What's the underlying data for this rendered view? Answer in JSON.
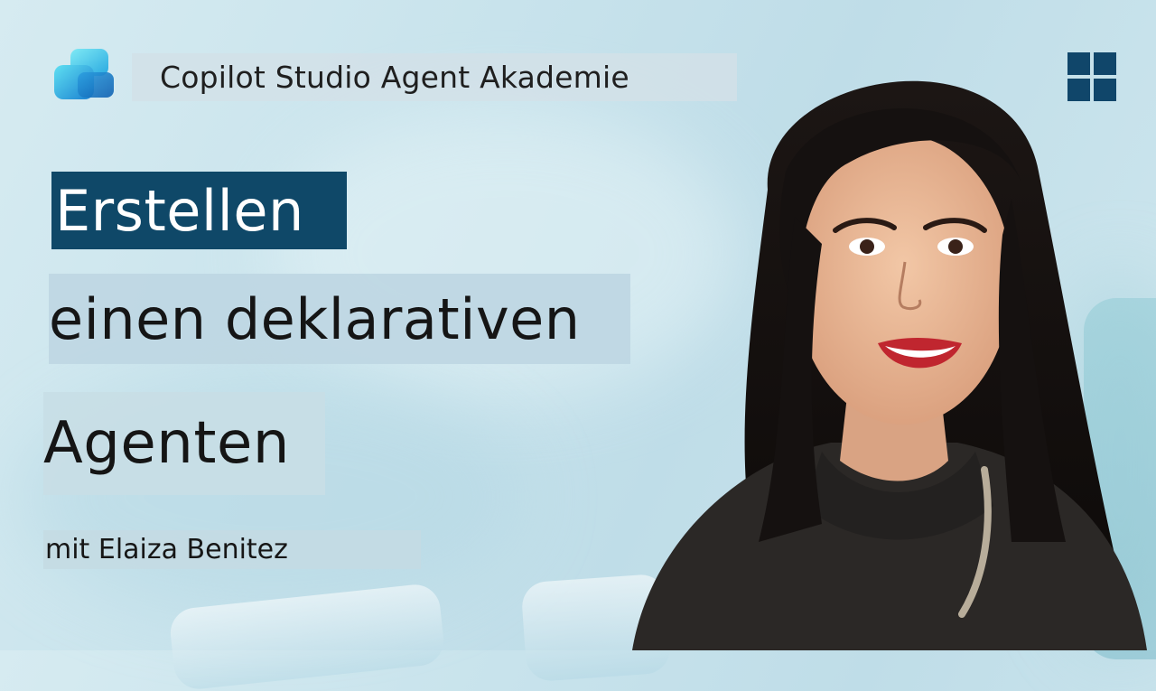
{
  "header": {
    "brand_text": "Copilot Studio Agent Akademie",
    "logo_icon": "copilot-studio-logo-icon",
    "partner_icon": "microsoft-windows-logo-icon"
  },
  "headline": {
    "line1": "Erstellen",
    "line2": "einen deklarativen",
    "line3": "Agenten"
  },
  "byline": "mit Elaiza Benitez",
  "colors": {
    "accent_dark_blue": "#0f4868",
    "logo_blue": "#10466a",
    "background": "#c8e3ec"
  }
}
